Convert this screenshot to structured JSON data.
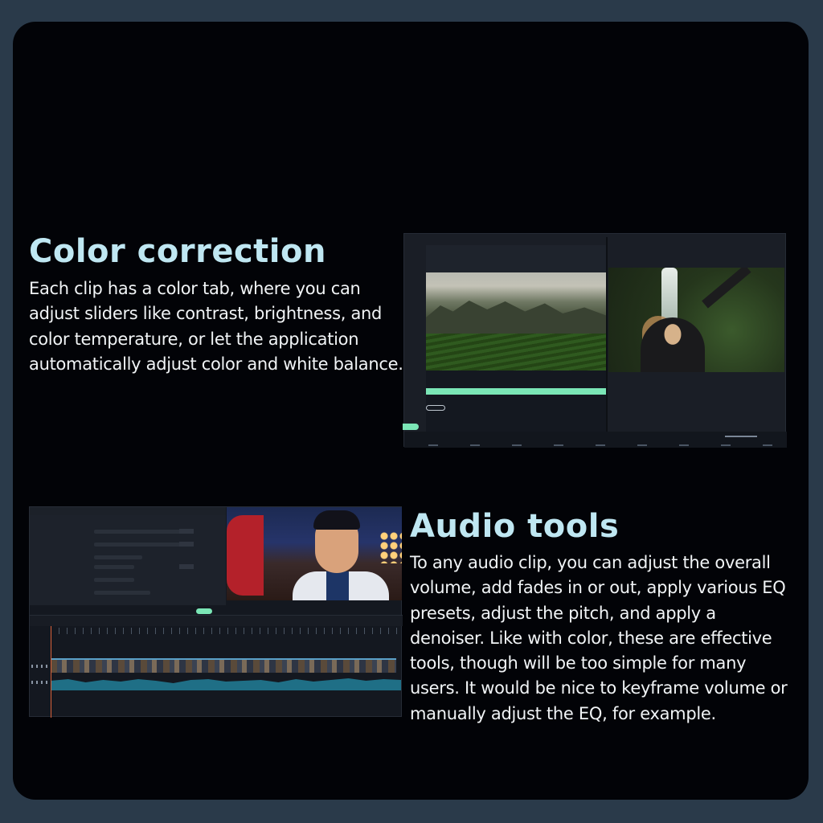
{
  "sections": [
    {
      "heading": "Color correction",
      "body": "Each clip has a color tab, where you can adjust sliders like contrast, brightness, and color temperature, or let the application automatically adjust color and white balance."
    },
    {
      "heading": "Audio tools",
      "body": "To any audio clip, you can adjust the overall volume, add fades in or out, apply various EQ presets, adjust the pitch, and apply a denoiser. Like with color, these are effective tools, though will be too simple for many users. It would be nice to keyframe volume or manually adjust the EQ, for example."
    }
  ],
  "colors": {
    "frame": "#2a3a4a",
    "card": "#020307",
    "heading": "#bfe7f2",
    "body": "#f1f4f6",
    "accent_green": "#7be6b6"
  },
  "screenshots": [
    {
      "name": "color-correction-screenshot"
    },
    {
      "name": "audio-tools-screenshot"
    }
  ]
}
